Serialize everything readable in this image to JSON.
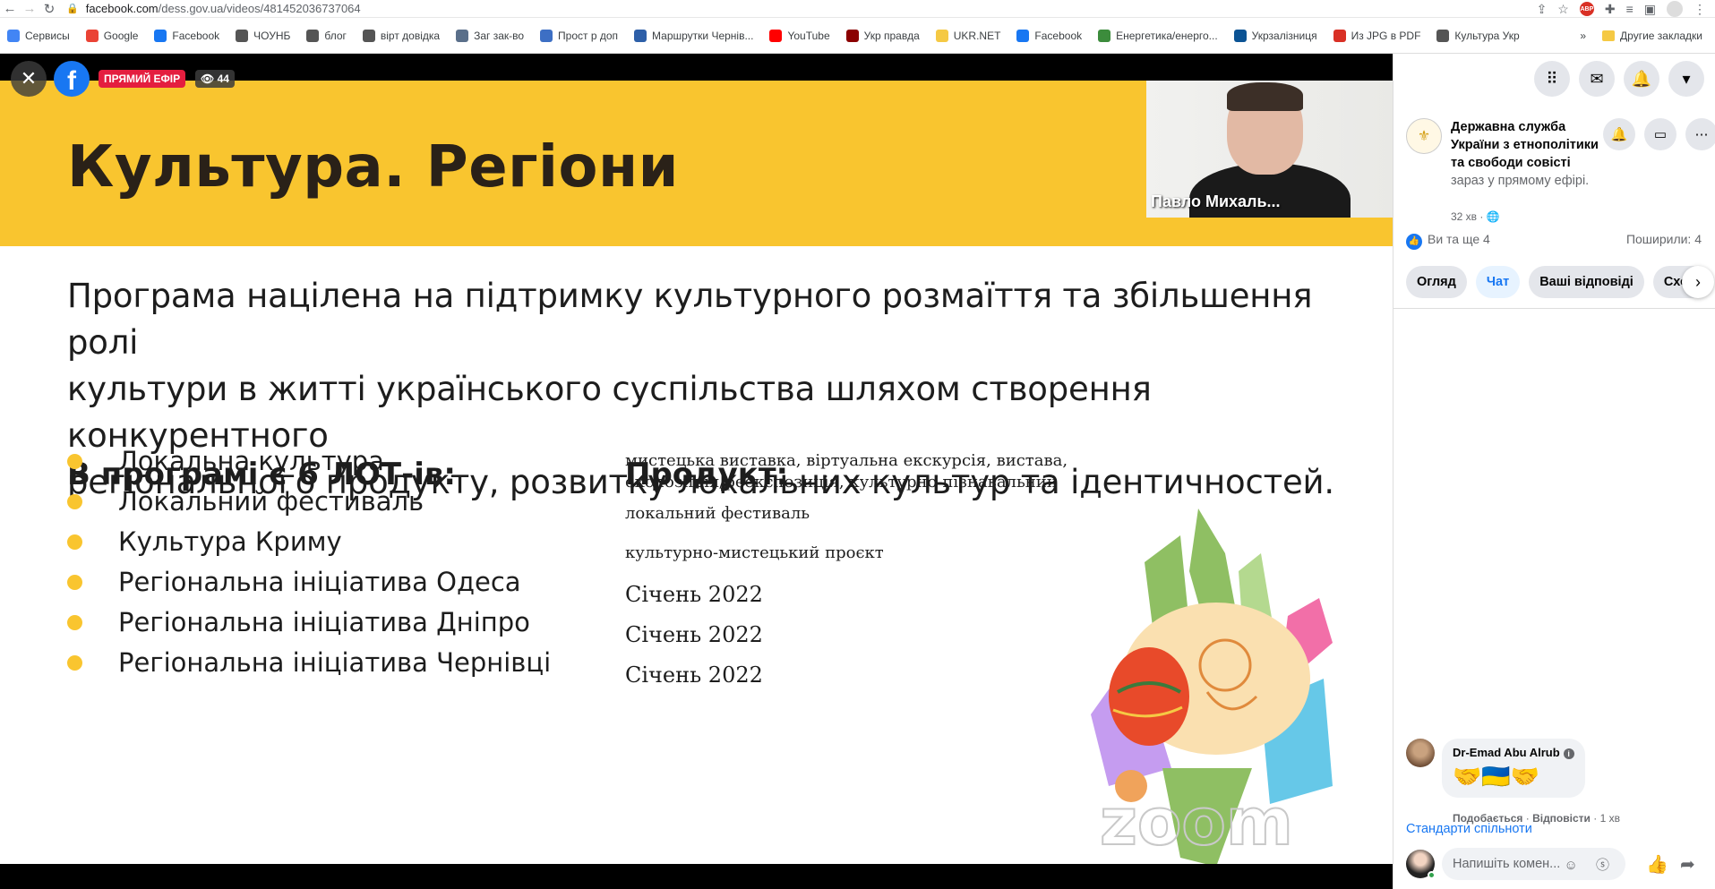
{
  "browser": {
    "url_domain": "facebook.com",
    "url_path": "/dess.gov.ua/videos/481452036737064",
    "bookmarks": [
      {
        "label": "Сервисы",
        "color": "#4285f4"
      },
      {
        "label": "Google",
        "color": "#ea4335"
      },
      {
        "label": "Facebook",
        "color": "#1877f2"
      },
      {
        "label": "ЧОУНБ",
        "color": "#555555"
      },
      {
        "label": "блог",
        "color": "#555555"
      },
      {
        "label": "вірт довідка",
        "color": "#555555"
      },
      {
        "label": "Заг зак-во",
        "color": "#5a6f8a"
      },
      {
        "label": "Прост р доп",
        "color": "#3d6fc4"
      },
      {
        "label": "Маршрутки Чернів...",
        "color": "#2d5fa8"
      },
      {
        "label": "YouTube",
        "color": "#ff0000"
      },
      {
        "label": "Укр правда",
        "color": "#8b0000"
      },
      {
        "label": "UKR.NET",
        "color": "#f5c944"
      },
      {
        "label": "Facebook",
        "color": "#1877f2"
      },
      {
        "label": "Енергетика/енерго...",
        "color": "#3c8c3c"
      },
      {
        "label": "Укрзалізниця",
        "color": "#0b5394"
      },
      {
        "label": "Из JPG в PDF",
        "color": "#d93025"
      },
      {
        "label": "Культура Укр",
        "color": "#555555"
      }
    ],
    "more_bookmarks": "»",
    "other_bookmarks": "Другие закладки"
  },
  "live": {
    "badge": "ПРЯМИЙ ЕФІР",
    "viewers": "44"
  },
  "slide": {
    "title": "Культура. Регіони",
    "speaker_name": "Павло Михаль...",
    "intro_lines": [
      "Програма націлена на підтримку культурного розмаїття та збільшення ролі",
      "культури в житті українського суспільства шляхом створення конкурентного",
      "регіонального продукту, розвитку локальних культур та ідентичностей."
    ],
    "lots_heading": "В програмі є 6 ЛОТ-ів:",
    "product_heading": "Продукт:",
    "lots": [
      {
        "name": "Локальна культура",
        "product_lines": [
          "мистецька виставка, віртуальна екскурсія, вистава,",
          "експозиція/реекспозиція, культурно-пізнавальний"
        ]
      },
      {
        "name": "Локальний фестиваль",
        "product_lines": [
          "локальний фестиваль"
        ]
      },
      {
        "name": "Культура Криму",
        "product_lines": [
          "культурно-мистецький проєкт"
        ]
      },
      {
        "name": "Регіональна ініціатива Одеса",
        "product_lines": [
          "Січень 2022"
        ]
      },
      {
        "name": "Регіональна ініціатива Дніпро",
        "product_lines": [
          "Січень 2022"
        ]
      },
      {
        "name": "Регіональна ініціатива Чернівці",
        "product_lines": [
          "Січень 2022"
        ]
      }
    ],
    "accent": "#f9c52f"
  },
  "panel": {
    "page_name": "Державна служба України з етнополітики та свободи совісті",
    "page_status": "зараз у прямому ефірі.",
    "time": "32 хв · ",
    "reactions_text": "Ви та ще 4",
    "shares": "Поширили: 4",
    "tabs": [
      "Огляд",
      "Чат",
      "Ваші відповіді",
      "Схож"
    ],
    "comment": {
      "author": "Dr-Emad Abu Alrub",
      "text": "🤝🇺🇦🤝",
      "like": "Подобається",
      "reply": "Відповісти",
      "time": "1 хв"
    },
    "standards": "Стандарти спільноти",
    "composer_placeholder": "Напишіть комен...",
    "brand_color": "#1877f2"
  }
}
